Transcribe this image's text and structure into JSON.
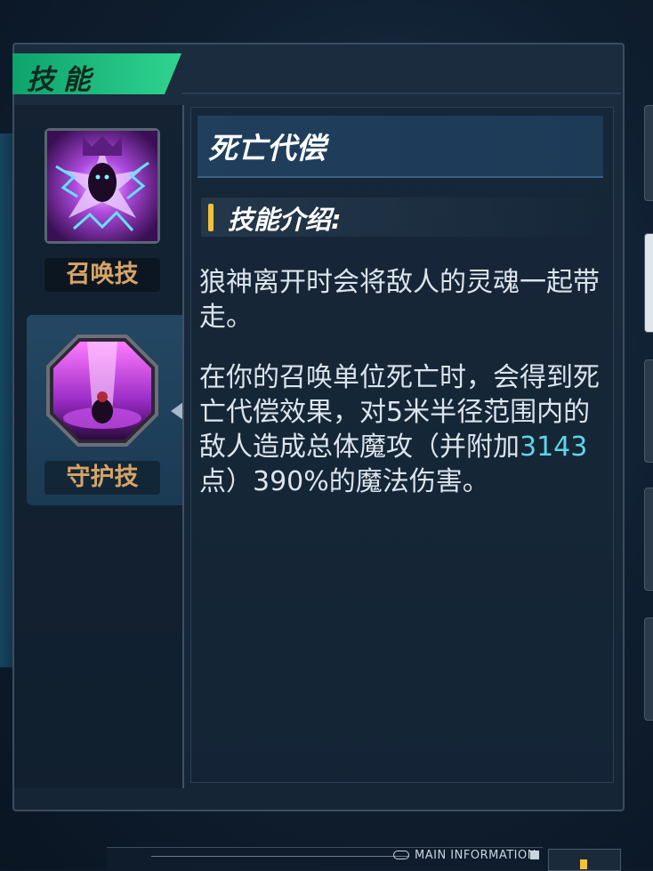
{
  "panel": {
    "tab_title": "技能"
  },
  "skills": [
    {
      "label": "召唤技",
      "icon": "summon-skill-icon",
      "selected": false
    },
    {
      "label": "守护技",
      "icon": "guardian-skill-icon",
      "selected": true
    }
  ],
  "detail": {
    "skill_name": "死亡代偿",
    "section_title": "技能介绍:",
    "paragraph1": "狼神离开时会将敌人的灵魂一起带走。",
    "paragraph2_before": "在你的召唤单位死亡时，会得到死亡代偿效果，对5米半径范围内的敌人造成总体魔攻（并附加",
    "paragraph2_value": "3143",
    "paragraph2_after": "点）390%的魔法伤害。"
  },
  "footer": {
    "label": "MAIN INFORMATION"
  },
  "colors": {
    "tab_green": "#2fd48f",
    "label_gold": "#d6a467",
    "highlight_cyan": "#5fd4e8",
    "accent_yellow": "#f2c13a"
  }
}
